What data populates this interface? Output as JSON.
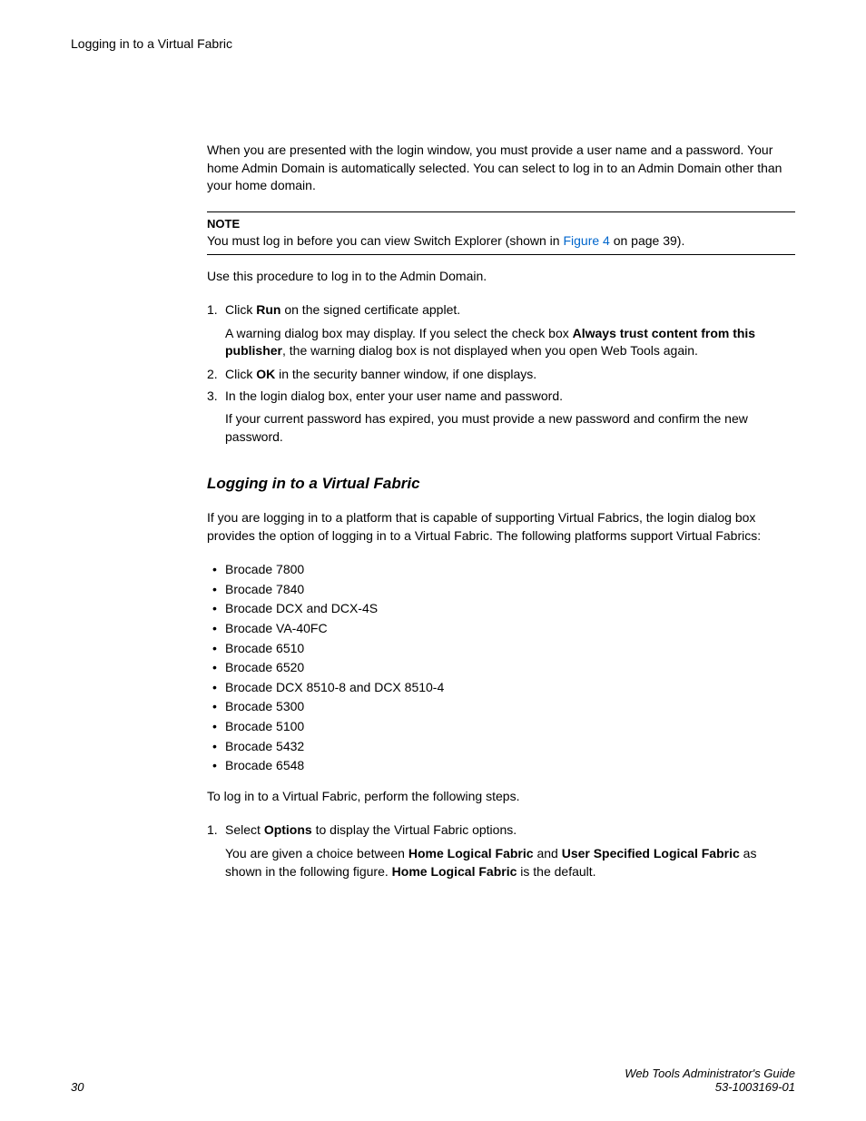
{
  "header": {
    "title": "Logging in to a Virtual Fabric"
  },
  "body": {
    "intro": "When you are presented with the login window, you must provide a user name and a password. Your home Admin Domain is automatically selected. You can select to log in to an Admin Domain other than your home domain.",
    "note": {
      "label": "NOTE",
      "text_before": "You must log in before you can view Switch Explorer (shown in ",
      "link": "Figure 4",
      "text_after": " on page 39)."
    },
    "use_procedure": "Use this procedure to log in to the Admin Domain.",
    "steps1": {
      "s1_pre": "Click ",
      "s1_bold": "Run",
      "s1_post": " on the signed certificate applet.",
      "s1_sub_pre": "A warning dialog box may display. If you select the check box ",
      "s1_sub_bold": "Always trust content from this publisher",
      "s1_sub_post": ", the warning dialog box is not displayed when you open Web Tools again.",
      "s2_pre": "Click ",
      "s2_bold": "OK",
      "s2_post": " in the security banner window, if one displays.",
      "s3": "In the login dialog box, enter your user name and password.",
      "s3_sub": "If your current password has expired, you must provide a new password and confirm the new password."
    },
    "section_heading": "Logging in to a Virtual Fabric",
    "vf_intro": "If you are logging in to a platform that is capable of supporting Virtual Fabrics, the login dialog box provides the option of logging in to a Virtual Fabric. The following platforms support Virtual Fabrics:",
    "platforms": [
      "Brocade 7800",
      "Brocade 7840",
      "Brocade DCX and DCX-4S",
      "Brocade VA-40FC",
      "Brocade 6510",
      "Brocade 6520",
      "Brocade DCX 8510-8 and DCX 8510-4",
      "Brocade 5300",
      "Brocade 5100",
      "Brocade 5432",
      "Brocade 6548"
    ],
    "vf_login_intro": "To log in to a Virtual Fabric, perform the following steps.",
    "steps2": {
      "s1_pre": "Select ",
      "s1_bold": "Options",
      "s1_post": " to display the Virtual Fabric options.",
      "s1_sub_pre": "You are given a choice between ",
      "s1_sub_b1": "Home Logical Fabric",
      "s1_sub_mid": " and ",
      "s1_sub_b2": "User Specified Logical Fabric",
      "s1_sub_mid2": " as shown in the following figure. ",
      "s1_sub_b3": "Home Logical Fabric",
      "s1_sub_post": " is the default."
    }
  },
  "footer": {
    "page": "30",
    "guide": "Web Tools Administrator's Guide",
    "docnum": "53-1003169-01"
  }
}
